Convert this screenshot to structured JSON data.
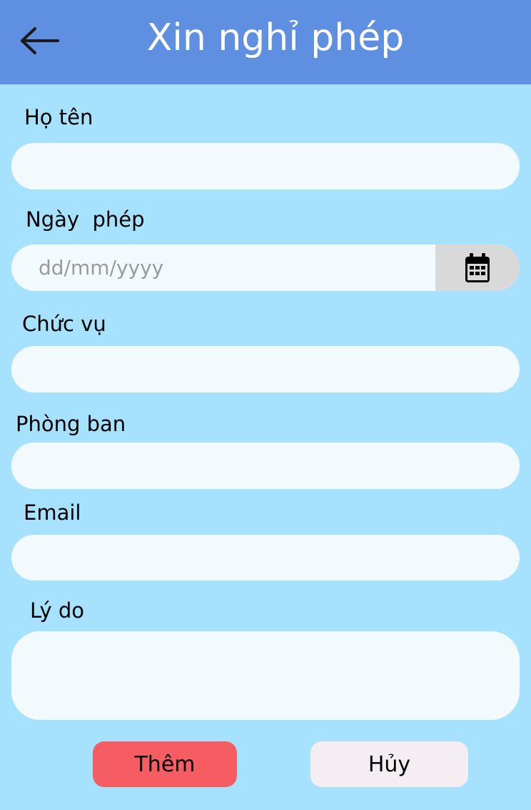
{
  "header": {
    "title": "Xin nghỉ phép",
    "background_color": "#5F8FE0",
    "back_icon": "arrow-left-icon"
  },
  "form": {
    "fullname": {
      "label": "Họ tên",
      "value": ""
    },
    "leave_date": {
      "label": "Ngày  phép",
      "placeholder": "dd/mm/yyyy",
      "value": "",
      "icon": "calendar-icon"
    },
    "position": {
      "label": "Chức vụ",
      "value": ""
    },
    "department": {
      "label": "Phòng ban",
      "value": ""
    },
    "email": {
      "label": "Email",
      "value": ""
    },
    "reason": {
      "label": "Lý do",
      "value": ""
    }
  },
  "actions": {
    "add_label": "Thêm",
    "add_color": "#F65D62",
    "cancel_label": "Hủy",
    "cancel_color": "#F4EEF2"
  },
  "colors": {
    "background": "#A6E1FE",
    "field_background": "#F3FAFE"
  }
}
